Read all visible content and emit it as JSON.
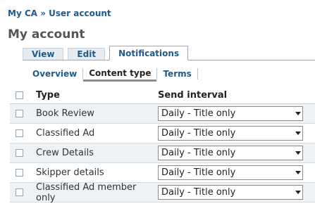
{
  "breadcrumb": "My CA » User account",
  "page_title": "My account",
  "tabs": [
    {
      "label": "View",
      "active": false
    },
    {
      "label": "Edit",
      "active": false
    },
    {
      "label": "Notifications",
      "active": true
    }
  ],
  "subtabs": [
    {
      "label": "Overview",
      "active": false
    },
    {
      "label": "Content type",
      "active": true
    },
    {
      "label": "Terms",
      "active": false
    }
  ],
  "table": {
    "headers": {
      "type": "Type",
      "interval": "Send interval"
    },
    "rows": [
      {
        "type": "Book Review",
        "interval": "Daily - Title only"
      },
      {
        "type": "Classified Ad",
        "interval": "Daily - Title only"
      },
      {
        "type": "Crew Details",
        "interval": "Daily - Title only"
      },
      {
        "type": "Skipper details",
        "interval": "Daily - Title only"
      },
      {
        "type": "Classified Ad member only",
        "interval": "Daily - Title only"
      }
    ]
  }
}
